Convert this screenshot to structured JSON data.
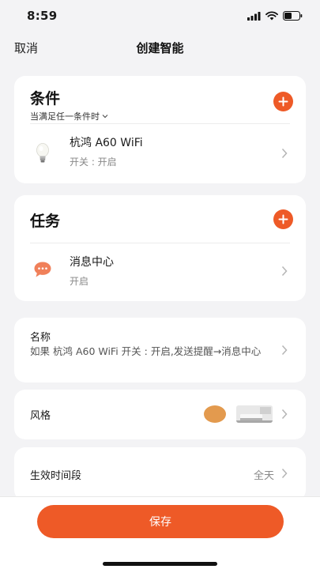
{
  "status_bar": {
    "time": "8:59"
  },
  "nav": {
    "cancel_label": "取消",
    "title": "创建智能"
  },
  "conditions": {
    "title": "条件",
    "subtitle": "当满足任一条件时",
    "items": [
      {
        "title": "杭鸿 A60 WiFi",
        "subtitle": "开关 : 开启",
        "icon": "light-bulb-icon"
      }
    ]
  },
  "tasks": {
    "title": "任务",
    "items": [
      {
        "title": "消息中心",
        "subtitle": "开启",
        "icon": "message-bubble-icon"
      }
    ]
  },
  "name_section": {
    "label": "名称",
    "value": "如果 杭鸿 A60 WiFi 开关 : 开启,发送提醒→消息中心"
  },
  "style_section": {
    "label": "风格",
    "accent_color": "#e39a4e"
  },
  "effective_period": {
    "label": "生效时间段",
    "value": "全天"
  },
  "footer": {
    "save_label": "保存"
  },
  "colors": {
    "accent": "#ee5a27",
    "background": "#f3f3f5",
    "card": "#ffffff"
  }
}
